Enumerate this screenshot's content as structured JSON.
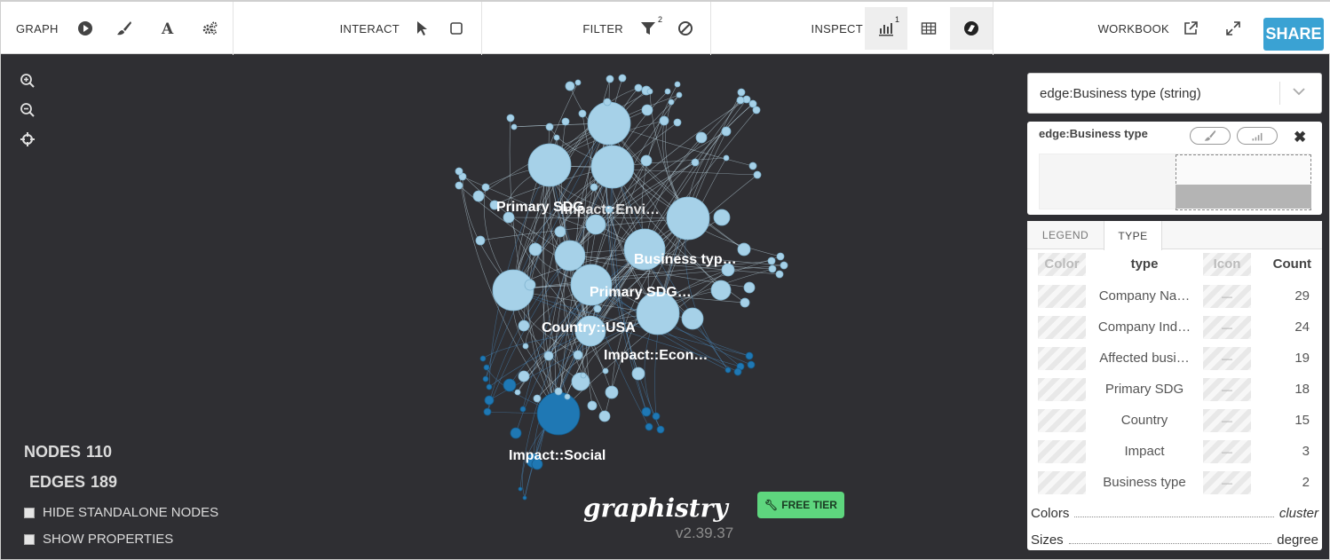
{
  "toolbar": {
    "graph_label": "GRAPH",
    "interact_label": "INTERACT",
    "filter_label": "FILTER",
    "filter_badge": "2",
    "inspect_label": "INSPECT",
    "inspect_badge": "1",
    "workbook_label": "WORKBOOK",
    "share_label": "SHARE",
    "icons": [
      "play-icon",
      "brush-icon",
      "font-icon",
      "settings-icon",
      "pointer-icon",
      "select-box-icon",
      "filter-icon",
      "exclude-icon",
      "histogram-icon",
      "table-icon",
      "timebar-icon",
      "external-link-icon",
      "fullscreen-icon"
    ]
  },
  "stats": {
    "nodes_label": "NODES",
    "nodes_value": "110",
    "edges_label": "EDGES",
    "edges_value": "189"
  },
  "options": {
    "hide_standalone": "HIDE STANDALONE NODES",
    "show_properties": "SHOW PROPERTIES"
  },
  "branding": {
    "logo_text": "graphistry",
    "version": "v2.39.37",
    "free_tier": "FREE TIER"
  },
  "graph": {
    "labels": [
      "Primary SDG",
      "Impact::Envi…",
      "Business typ…",
      "Primary SDG…",
      "Country::USA",
      "Impact::Econ…",
      "Impact::Social"
    ],
    "colors": {
      "light": "#a6d1e8",
      "dark": "#1f78b4",
      "edge": "#c9e3f1",
      "background": "#2f2f33"
    }
  },
  "panel": {
    "attribute_select": "edge:Business type (string)",
    "histogram_title": "edge:Business type",
    "tabs": [
      "LEGEND",
      "TYPE"
    ],
    "active_tab": "TYPE",
    "columns": {
      "color": "Color",
      "type": "type",
      "icon": "Icon",
      "count": "Count"
    },
    "rows": [
      {
        "type": "Company Na…",
        "icon": "—",
        "count": "29"
      },
      {
        "type": "Company Ind…",
        "icon": "—",
        "count": "24"
      },
      {
        "type": "Affected busi…",
        "icon": "—",
        "count": "19"
      },
      {
        "type": "Primary SDG",
        "icon": "—",
        "count": "18"
      },
      {
        "type": "Country",
        "icon": "—",
        "count": "15"
      },
      {
        "type": "Impact",
        "icon": "—",
        "count": "3"
      },
      {
        "type": "Business type",
        "icon": "—",
        "count": "2"
      }
    ],
    "colors_label": "Colors",
    "colors_value": "cluster",
    "sizes_label": "Sizes",
    "sizes_value": "degree"
  }
}
